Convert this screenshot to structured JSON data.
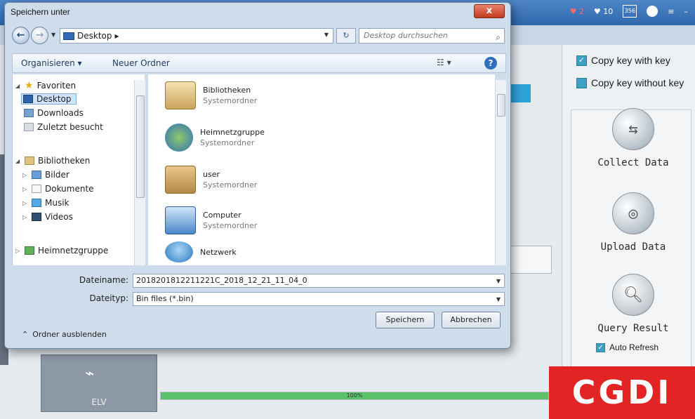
{
  "dialog": {
    "title": "Speichern unter",
    "close_glyph": "x",
    "address": {
      "segments": [
        "Desktop",
        "▸"
      ]
    },
    "search_placeholder": "Desktop durchsuchen",
    "toolbar": {
      "organize": "Organisieren ▾",
      "new_folder": "Neuer Ordner"
    },
    "nav": {
      "favorites": "Favoriten",
      "desktop": "Desktop",
      "downloads": "Downloads",
      "recent": "Zuletzt besucht",
      "libraries": "Bibliotheken",
      "pictures": "Bilder",
      "documents": "Dokumente",
      "music": "Musik",
      "videos": "Videos",
      "homegroup": "Heimnetzgruppe"
    },
    "files": [
      {
        "name": "Bibliotheken",
        "sub": "Systemordner",
        "icon": "library-icon"
      },
      {
        "name": "Heimnetzgruppe",
        "sub": "Systemordner",
        "icon": "homegroup-icon"
      },
      {
        "name": "user",
        "sub": "Systemordner",
        "icon": "user-folder-icon"
      },
      {
        "name": "Computer",
        "sub": "Systemordner",
        "icon": "computer-icon"
      },
      {
        "name": "Netzwerk",
        "sub": "",
        "icon": "network-icon"
      }
    ],
    "filename_label": "Dateiname:",
    "filename_value": "2018201812211221C_2018_12_21_11_04_0",
    "filetype_label": "Dateityp:",
    "filetype_value": "Bin files (*.bin)",
    "save_button": "Speichern",
    "cancel_button": "Abbrechen",
    "hide_folders": "Ordner ausblenden"
  },
  "app": {
    "top_icons": {
      "heart_count": "2",
      "likes_count": "10",
      "box_text": "356"
    },
    "options": {
      "copy_with_key": "Copy key with key",
      "copy_without_key": "Copy key without key"
    },
    "buttons": {
      "collect": "Collect Data",
      "upload": "Upload  Data",
      "query": "Query Result"
    },
    "auto_refresh": "Auto Refresh",
    "tile_label": "ELV",
    "progress_text": "100%",
    "progress": 1.0,
    "brand": "CGDI",
    "brand_color": "#e32424"
  }
}
